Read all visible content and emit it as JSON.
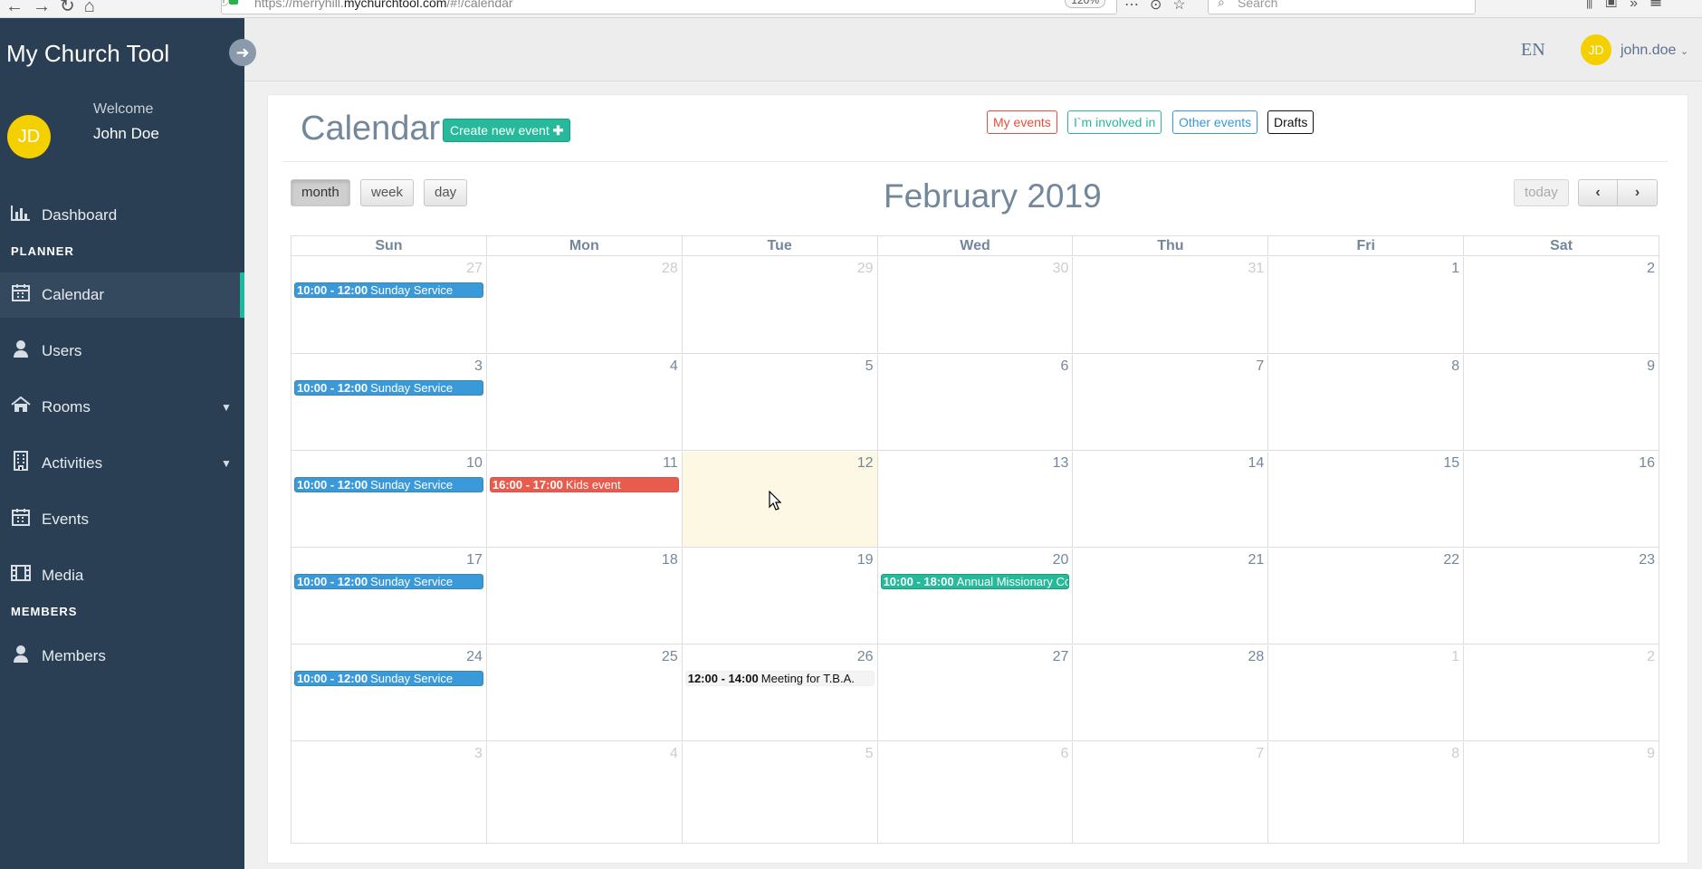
{
  "browser": {
    "url_prefix": "https://merryhill.",
    "url_host": "mychurchtool.com",
    "url_path": "/#!/calendar",
    "zoom": "120%",
    "search_placeholder": "Search"
  },
  "sidebar": {
    "brand": "My Church Tool",
    "avatar_initials": "JD",
    "welcome": "Welcome",
    "user_name": "John Doe",
    "items": [
      {
        "label": "Dashboard",
        "icon": "bar-chart-icon"
      },
      {
        "label": "Calendar",
        "icon": "calendar-icon",
        "active": true
      },
      {
        "label": "Users",
        "icon": "user-icon"
      },
      {
        "label": "Rooms",
        "icon": "home-icon"
      },
      {
        "label": "Activities",
        "icon": "building-icon"
      },
      {
        "label": "Events",
        "icon": "calendar-icon"
      },
      {
        "label": "Media",
        "icon": "film-icon"
      },
      {
        "label": "Members",
        "icon": "user-icon"
      }
    ],
    "sections": {
      "planner": "PLANNER",
      "members": "MEMBERS"
    }
  },
  "topnav": {
    "language": "EN",
    "avatar_initials": "JD",
    "username": "john.doe"
  },
  "page": {
    "title": "Calendar",
    "create_button": "Create new event",
    "filters": {
      "mine": "My events",
      "involved": "I`m involved in",
      "other": "Other events",
      "drafts": "Drafts"
    }
  },
  "calendar": {
    "views": {
      "month": "month",
      "week": "week",
      "day": "day"
    },
    "title": "February 2019",
    "today_label": "today",
    "prev_label": "‹",
    "next_label": "›",
    "weekdays": [
      "Sun",
      "Mon",
      "Tue",
      "Wed",
      "Thu",
      "Fri",
      "Sat"
    ],
    "weeks": [
      [
        "27",
        "28",
        "29",
        "30",
        "31",
        "1",
        "2"
      ],
      [
        "3",
        "4",
        "5",
        "6",
        "7",
        "8",
        "9"
      ],
      [
        "10",
        "11",
        "12",
        "13",
        "14",
        "15",
        "16"
      ],
      [
        "17",
        "18",
        "19",
        "20",
        "21",
        "22",
        "23"
      ],
      [
        "24",
        "25",
        "26",
        "27",
        "28",
        "1",
        "2"
      ],
      [
        "3",
        "4",
        "5",
        "6",
        "7",
        "8",
        "9"
      ]
    ],
    "events": {
      "w0sun": {
        "time": "10:00 - 12:00",
        "title": "Sunday Service"
      },
      "w1sun": {
        "time": "10:00 - 12:00",
        "title": "Sunday Service"
      },
      "w2sun": {
        "time": "10:00 - 12:00",
        "title": "Sunday Service"
      },
      "w2mon": {
        "time": "16:00 - 17:00",
        "title": "Kids event"
      },
      "w3sun": {
        "time": "10:00 - 12:00",
        "title": "Sunday Service"
      },
      "w3wed": {
        "time": "10:00 - 18:00",
        "title": "Annual Missionary Co"
      },
      "w4sun": {
        "time": "10:00 - 12:00",
        "title": "Sunday Service"
      },
      "w4tue": {
        "time": "12:00 - 14:00",
        "title": "Meeting for T.B.A."
      }
    }
  }
}
